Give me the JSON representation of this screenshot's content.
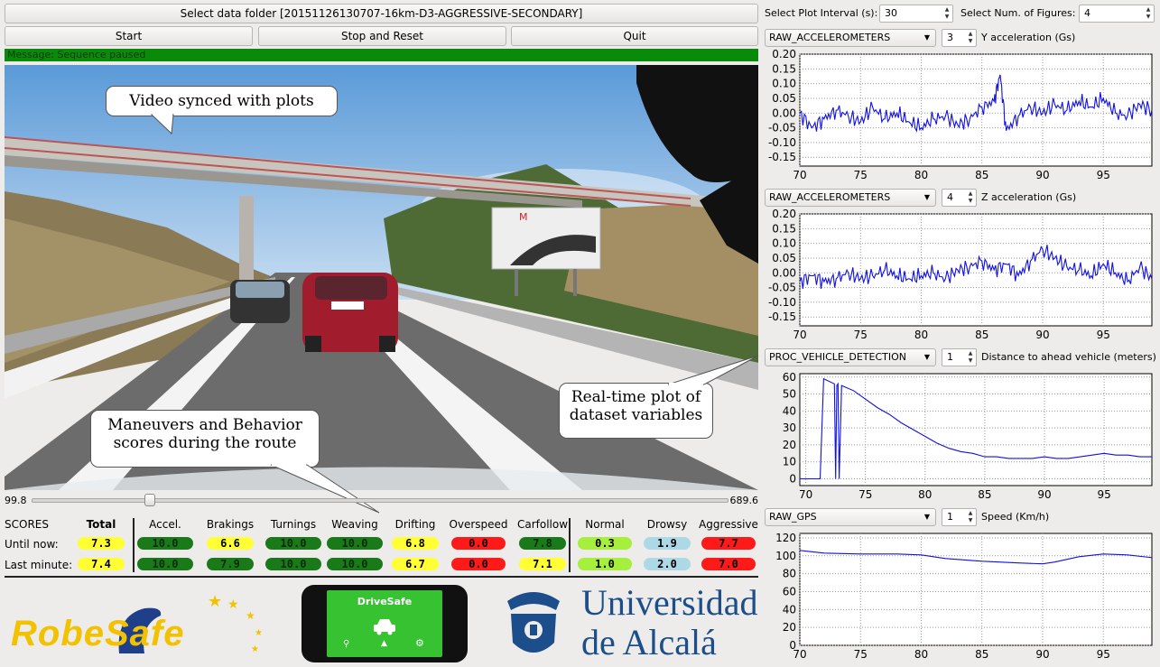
{
  "toolbar": {
    "folder_label": "Select data folder [20151126130707-16km-D3-AGGRESSIVE-SECONDARY]",
    "start_label": "Start",
    "stop_label": "Stop and Reset",
    "quit_label": "Quit"
  },
  "message": "Message: Sequence paused",
  "settings": {
    "interval_label": "Select Plot Interval (s):",
    "interval_value": "30",
    "figures_label": "Select Num. of Figures:",
    "figures_value": "4"
  },
  "callouts": {
    "video": "Video synced with plots",
    "plots_line1": "Real-time plot of",
    "plots_line2": "dataset variables",
    "scores_line1": "Maneuvers and Behavior",
    "scores_line2": "scores during the route"
  },
  "video": {
    "sign_text": "M"
  },
  "slider": {
    "min_label": "99.8",
    "max_label": "689.6",
    "position": 0.17
  },
  "scores": {
    "title": "SCORES",
    "headers": [
      "Total",
      "Accel.",
      "Brakings",
      "Turnings",
      "Weaving",
      "Drifting",
      "Overspeed",
      "Carfollow",
      "Normal",
      "Drowsy",
      "Aggressive"
    ],
    "rows": [
      {
        "label": "Until now:",
        "values": [
          "7.3",
          "10.0",
          "6.6",
          "10.0",
          "10.0",
          "6.8",
          "0.0",
          "7.8",
          "0.3",
          "1.9",
          "7.7"
        ]
      },
      {
        "label": "Last minute:",
        "values": [
          "7.4",
          "10.0",
          "7.9",
          "10.0",
          "10.0",
          "6.7",
          "0.0",
          "7.1",
          "1.0",
          "2.0",
          "7.0"
        ]
      }
    ],
    "colors": [
      [
        "#ffff33",
        "#1a7a1a",
        "#ffff33",
        "#1a7a1a",
        "#1a7a1a",
        "#ffff33",
        "#ff1a1a",
        "#1a7a1a",
        "#a6ef3c",
        "#add8e6",
        "#ff1a1a"
      ],
      [
        "#ffff33",
        "#1a7a1a",
        "#1a7a1a",
        "#1a7a1a",
        "#1a7a1a",
        "#ffff33",
        "#ff1a1a",
        "#ffff33",
        "#a6ef3c",
        "#add8e6",
        "#ff1a1a"
      ]
    ]
  },
  "logos": {
    "robesafe": "RobeSafe",
    "app_title": "DriveSafe",
    "uni_line1": "Universidad",
    "uni_line2": "de Alcalá"
  },
  "plots": [
    {
      "source": "RAW_ACCELEROMETERS",
      "index": "3",
      "label": "Y acceleration (Gs)",
      "chart_data": {
        "type": "line",
        "xlim": [
          70,
          99
        ],
        "ylim": [
          -0.18,
          0.2
        ],
        "xticks": [
          "70",
          "75",
          "80",
          "85",
          "90",
          "95"
        ],
        "yticks": [
          "0.20",
          "0.15",
          "0.10",
          "0.05",
          "0.00",
          "-0.05",
          "-0.10",
          "-0.15"
        ],
        "grid": true,
        "x": [
          70,
          71,
          72,
          73,
          74,
          75,
          76,
          77,
          78,
          79,
          80,
          81,
          82,
          83,
          84,
          85,
          86,
          86.5,
          87,
          88,
          89,
          90,
          91,
          92,
          93,
          94,
          95,
          96,
          97,
          98,
          99
        ],
        "y": [
          0.0,
          -0.05,
          -0.02,
          0.01,
          -0.01,
          -0.03,
          0.02,
          -0.02,
          0.0,
          -0.03,
          -0.05,
          -0.02,
          -0.01,
          -0.04,
          -0.02,
          0.02,
          0.04,
          0.13,
          -0.06,
          -0.01,
          0.02,
          0.0,
          0.03,
          0.01,
          0.04,
          0.02,
          0.05,
          0.0,
          -0.01,
          0.03,
          0.01
        ]
      }
    },
    {
      "source": "RAW_ACCELEROMETERS",
      "index": "4",
      "label": "Z acceleration (Gs)",
      "chart_data": {
        "type": "line",
        "xlim": [
          70,
          99
        ],
        "ylim": [
          -0.18,
          0.2
        ],
        "xticks": [
          "70",
          "75",
          "80",
          "85",
          "90",
          "95"
        ],
        "yticks": [
          "0.20",
          "0.15",
          "0.10",
          "0.05",
          "0.00",
          "-0.05",
          "-0.10",
          "-0.15"
        ],
        "grid": true,
        "x": [
          70,
          71,
          72,
          73,
          74,
          75,
          76,
          77,
          78,
          79,
          80,
          81,
          82,
          83,
          84,
          85,
          86,
          87,
          88,
          89,
          90,
          91,
          92,
          93,
          94,
          95,
          96,
          97,
          98,
          99
        ],
        "y": [
          -0.03,
          -0.01,
          -0.03,
          -0.02,
          0.0,
          -0.02,
          -0.01,
          0.01,
          -0.01,
          -0.02,
          -0.01,
          0.0,
          -0.02,
          0.01,
          0.02,
          0.04,
          0.01,
          0.03,
          -0.01,
          0.04,
          0.08,
          0.05,
          0.02,
          0.01,
          -0.01,
          0.03,
          0.0,
          -0.03,
          0.02,
          -0.02
        ]
      }
    },
    {
      "source": "PROC_VEHICLE_DETECTION",
      "index": "1",
      "label": "Distance to ahead vehicle (meters)",
      "chart_data": {
        "type": "line",
        "xlim": [
          69.5,
          99
        ],
        "ylim": [
          -4,
          62
        ],
        "xticks": [
          "70",
          "75",
          "80",
          "85",
          "90",
          "95"
        ],
        "yticks": [
          "60",
          "50",
          "40",
          "30",
          "20",
          "10",
          "0"
        ],
        "grid": true,
        "x": [
          69.5,
          71.2,
          71.5,
          72.4,
          72.5,
          72.6,
          72.7,
          72.8,
          73.0,
          74,
          75,
          76,
          77,
          78,
          79,
          80,
          81,
          82,
          83,
          84,
          85,
          86,
          87,
          88,
          89,
          90,
          91,
          92,
          93,
          94,
          95,
          96,
          97,
          98,
          99
        ],
        "y": [
          0,
          0,
          59,
          56,
          0,
          55,
          56,
          0,
          55,
          52,
          47,
          42,
          38,
          33,
          29,
          25,
          21,
          18,
          16,
          15,
          13,
          13,
          12,
          12,
          12,
          13,
          12,
          12,
          13,
          14,
          15,
          14,
          14,
          13,
          13
        ]
      }
    },
    {
      "source": "RAW_GPS",
      "index": "1",
      "label": "Speed (Km/h)",
      "chart_data": {
        "type": "line",
        "xlim": [
          70,
          99
        ],
        "ylim": [
          0,
          125
        ],
        "xticks": [
          "70",
          "75",
          "80",
          "85",
          "90",
          "95"
        ],
        "yticks": [
          "120",
          "100",
          "80",
          "60",
          "40",
          "20",
          "0"
        ],
        "grid": true,
        "x": [
          70,
          72,
          75,
          78,
          80,
          82,
          85,
          88,
          90,
          91,
          93,
          95,
          97,
          99
        ],
        "y": [
          106,
          103,
          102,
          102,
          101,
          97,
          94,
          92,
          91,
          93,
          99,
          102,
          101,
          98
        ]
      }
    }
  ]
}
